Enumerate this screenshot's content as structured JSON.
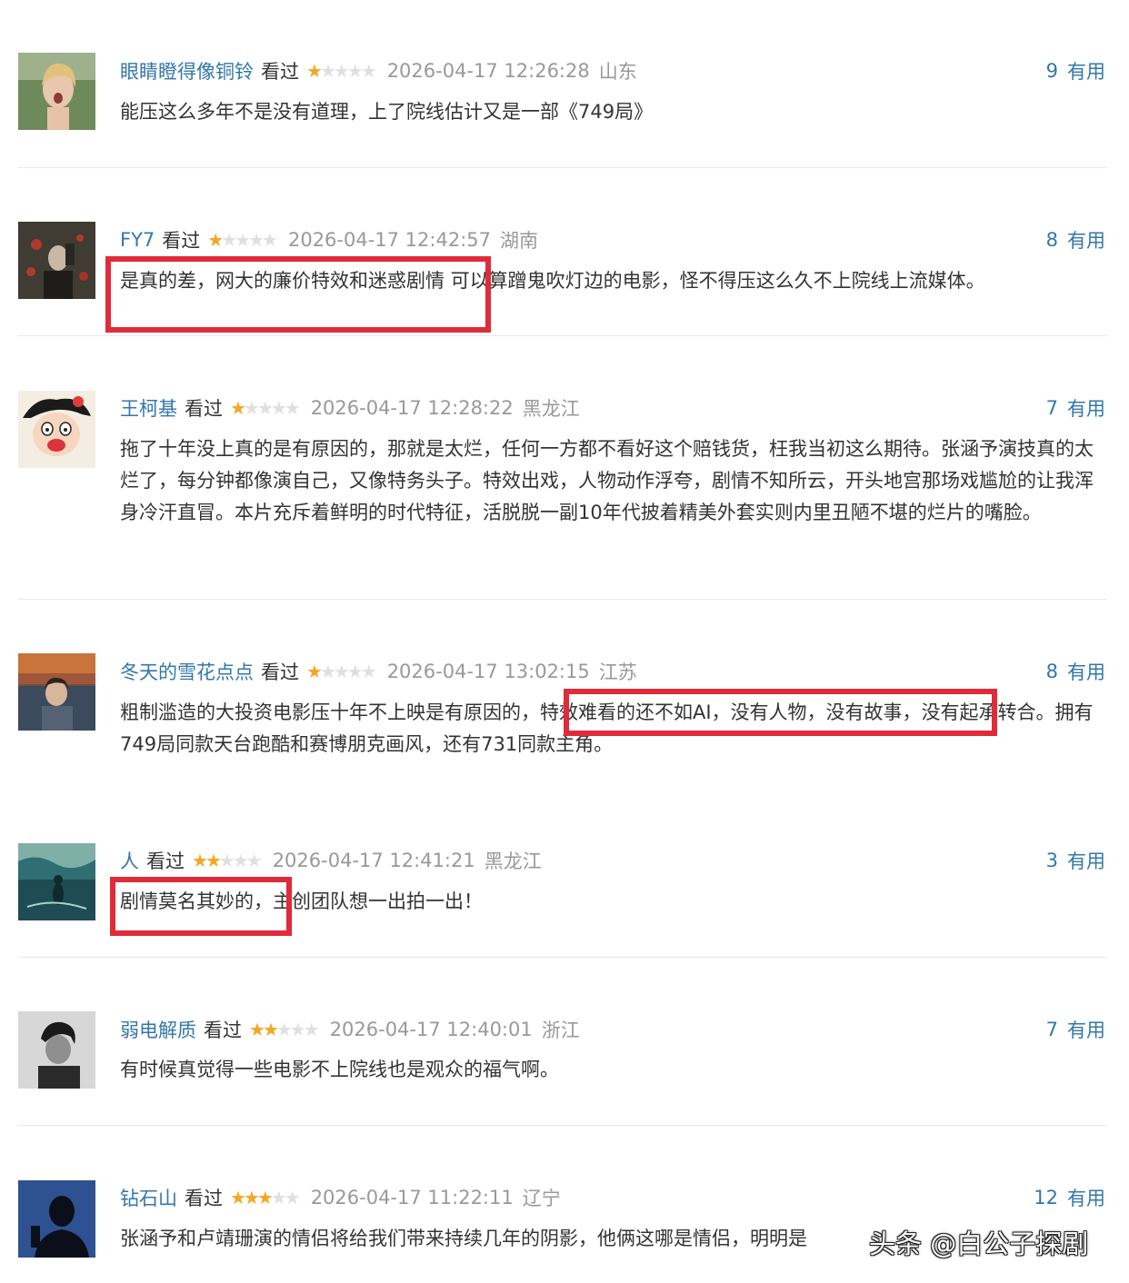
{
  "reviews": [
    {
      "user": "眼睛瞪得像铜铃",
      "status": "看过",
      "rating": 1,
      "time": "2026-04-17 12:26:28",
      "region": "山东",
      "votes": "9",
      "useful": "有用",
      "content": "能压这么多年不是没有道理，上了院线估计又是一部《749局》"
    },
    {
      "user": "FY7",
      "status": "看过",
      "rating": 1,
      "time": "2026-04-17 12:42:57",
      "region": "湖南",
      "votes": "8",
      "useful": "有用",
      "content": "是真的差，网大的廉价特效和迷惑剧情 可以算蹭鬼吹灯边的电影，怪不得压这么久不上院线上流媒体。"
    },
    {
      "user": "王柯基",
      "status": "看过",
      "rating": 1,
      "time": "2026-04-17 12:28:22",
      "region": "黑龙江",
      "votes": "7",
      "useful": "有用",
      "content": "拖了十年没上真的是有原因的，那就是太烂，任何一方都不看好这个赔钱货，枉我当初这么期待。张涵予演技真的太烂了，每分钟都像演自己，又像特务头子。特效出戏，人物动作浮夸，剧情不知所云，开头地宫那场戏尴尬的让我浑身冷汗直冒。本片充斥着鲜明的时代特征，活脱脱一副10年代披着精美外套实则内里丑陋不堪的烂片的嘴脸。"
    },
    {
      "user": "冬天的雪花点点",
      "status": "看过",
      "rating": 1,
      "time": "2026-04-17 13:02:15",
      "region": "江苏",
      "votes": "8",
      "useful": "有用",
      "content": "粗制滥造的大投资电影压十年不上映是有原因的，特效难看的还不如AI，没有人物，没有故事，没有起承转合。拥有749局同款天台跑酷和赛博朋克画风，还有731同款主角。"
    },
    {
      "user": "人",
      "status": "看过",
      "rating": 2,
      "time": "2026-04-17 12:41:21",
      "region": "黑龙江",
      "votes": "3",
      "useful": "有用",
      "content": "剧情莫名其妙的，主创团队想一出拍一出！"
    },
    {
      "user": "弱电解质",
      "status": "看过",
      "rating": 2,
      "time": "2026-04-17 12:40:01",
      "region": "浙江",
      "votes": "7",
      "useful": "有用",
      "content": "有时候真觉得一些电影不上院线也是观众的福气啊。"
    },
    {
      "user": "钻石山",
      "status": "看过",
      "rating": 3,
      "time": "2026-04-17 11:22:11",
      "region": "辽宁",
      "votes": "12",
      "useful": "有用",
      "content": "张涵予和卢靖珊演的情侣将给我们带来持续几年的阴影，他俩这哪是情侣，明明是"
    }
  ],
  "watermark": "头条 @白公子探剧",
  "colors": {
    "link": "#3377aa",
    "star": "#f5a623",
    "highlight": "#e02b3a"
  }
}
